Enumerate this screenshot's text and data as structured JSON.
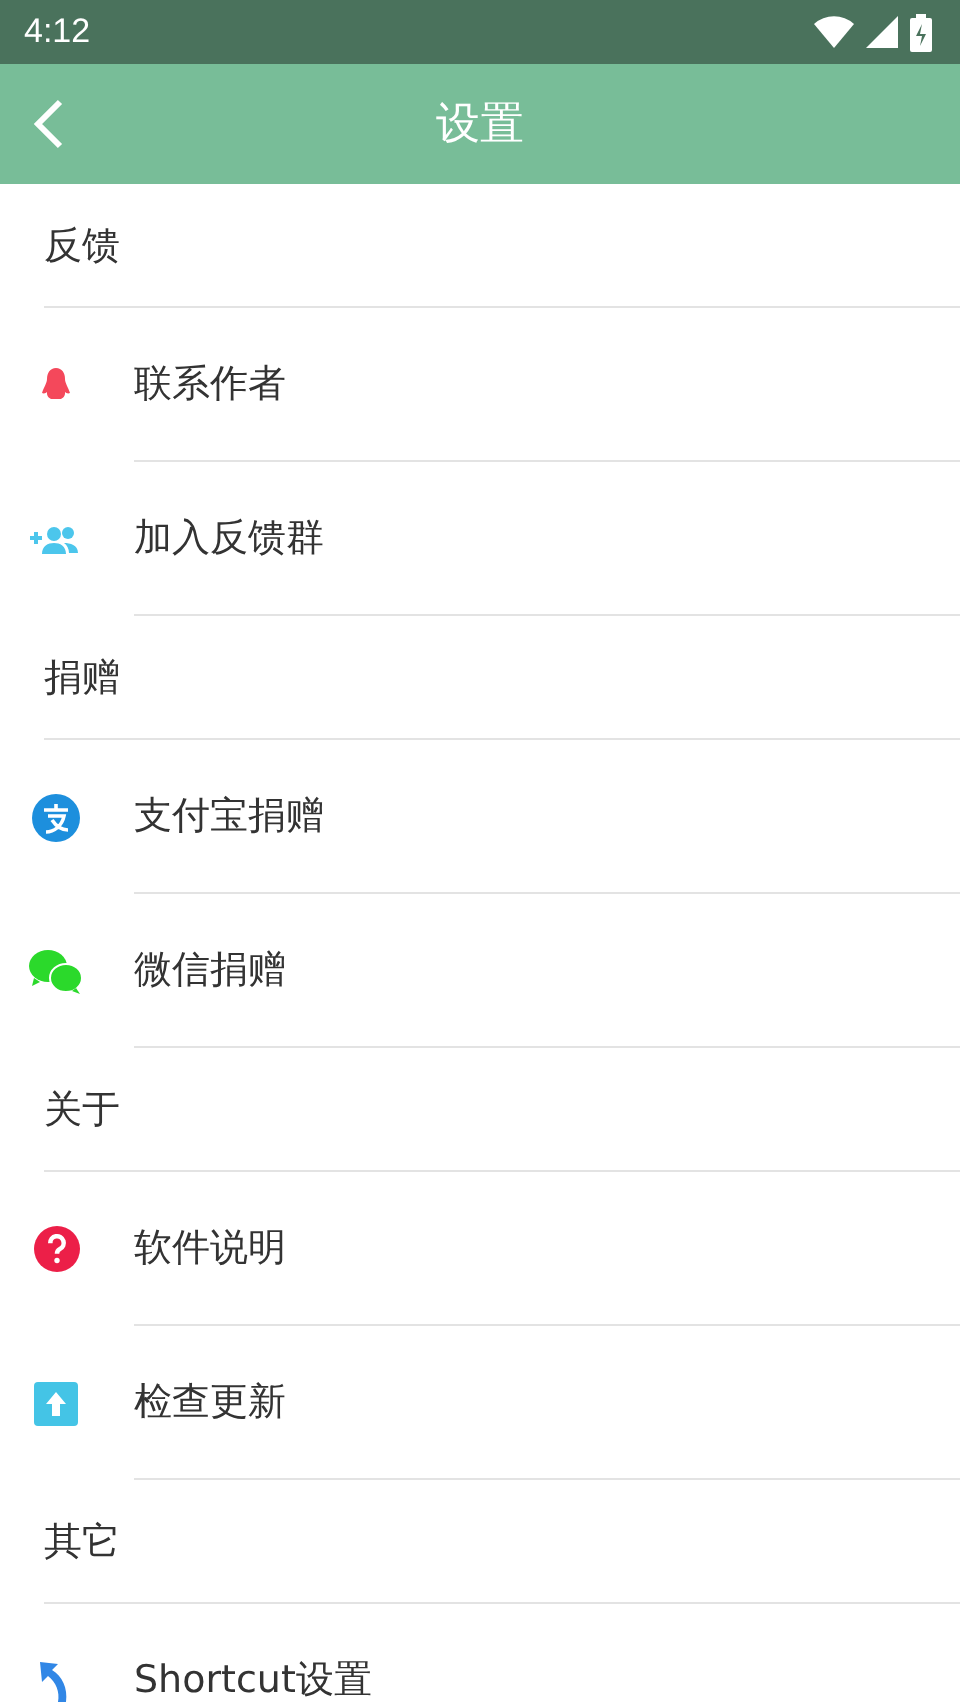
{
  "status_bar": {
    "time": "4:12"
  },
  "toolbar": {
    "title": "设置"
  },
  "sections": [
    {
      "title": "反馈",
      "items": [
        {
          "label": "联系作者"
        },
        {
          "label": "加入反馈群"
        }
      ]
    },
    {
      "title": "捐赠",
      "items": [
        {
          "label": "支付宝捐赠"
        },
        {
          "label": "微信捐赠"
        }
      ]
    },
    {
      "title": "关于",
      "items": [
        {
          "label": "软件说明"
        },
        {
          "label": "检查更新"
        }
      ]
    },
    {
      "title": "其它",
      "items": [
        {
          "label": "Shortcut设置"
        }
      ]
    }
  ]
}
